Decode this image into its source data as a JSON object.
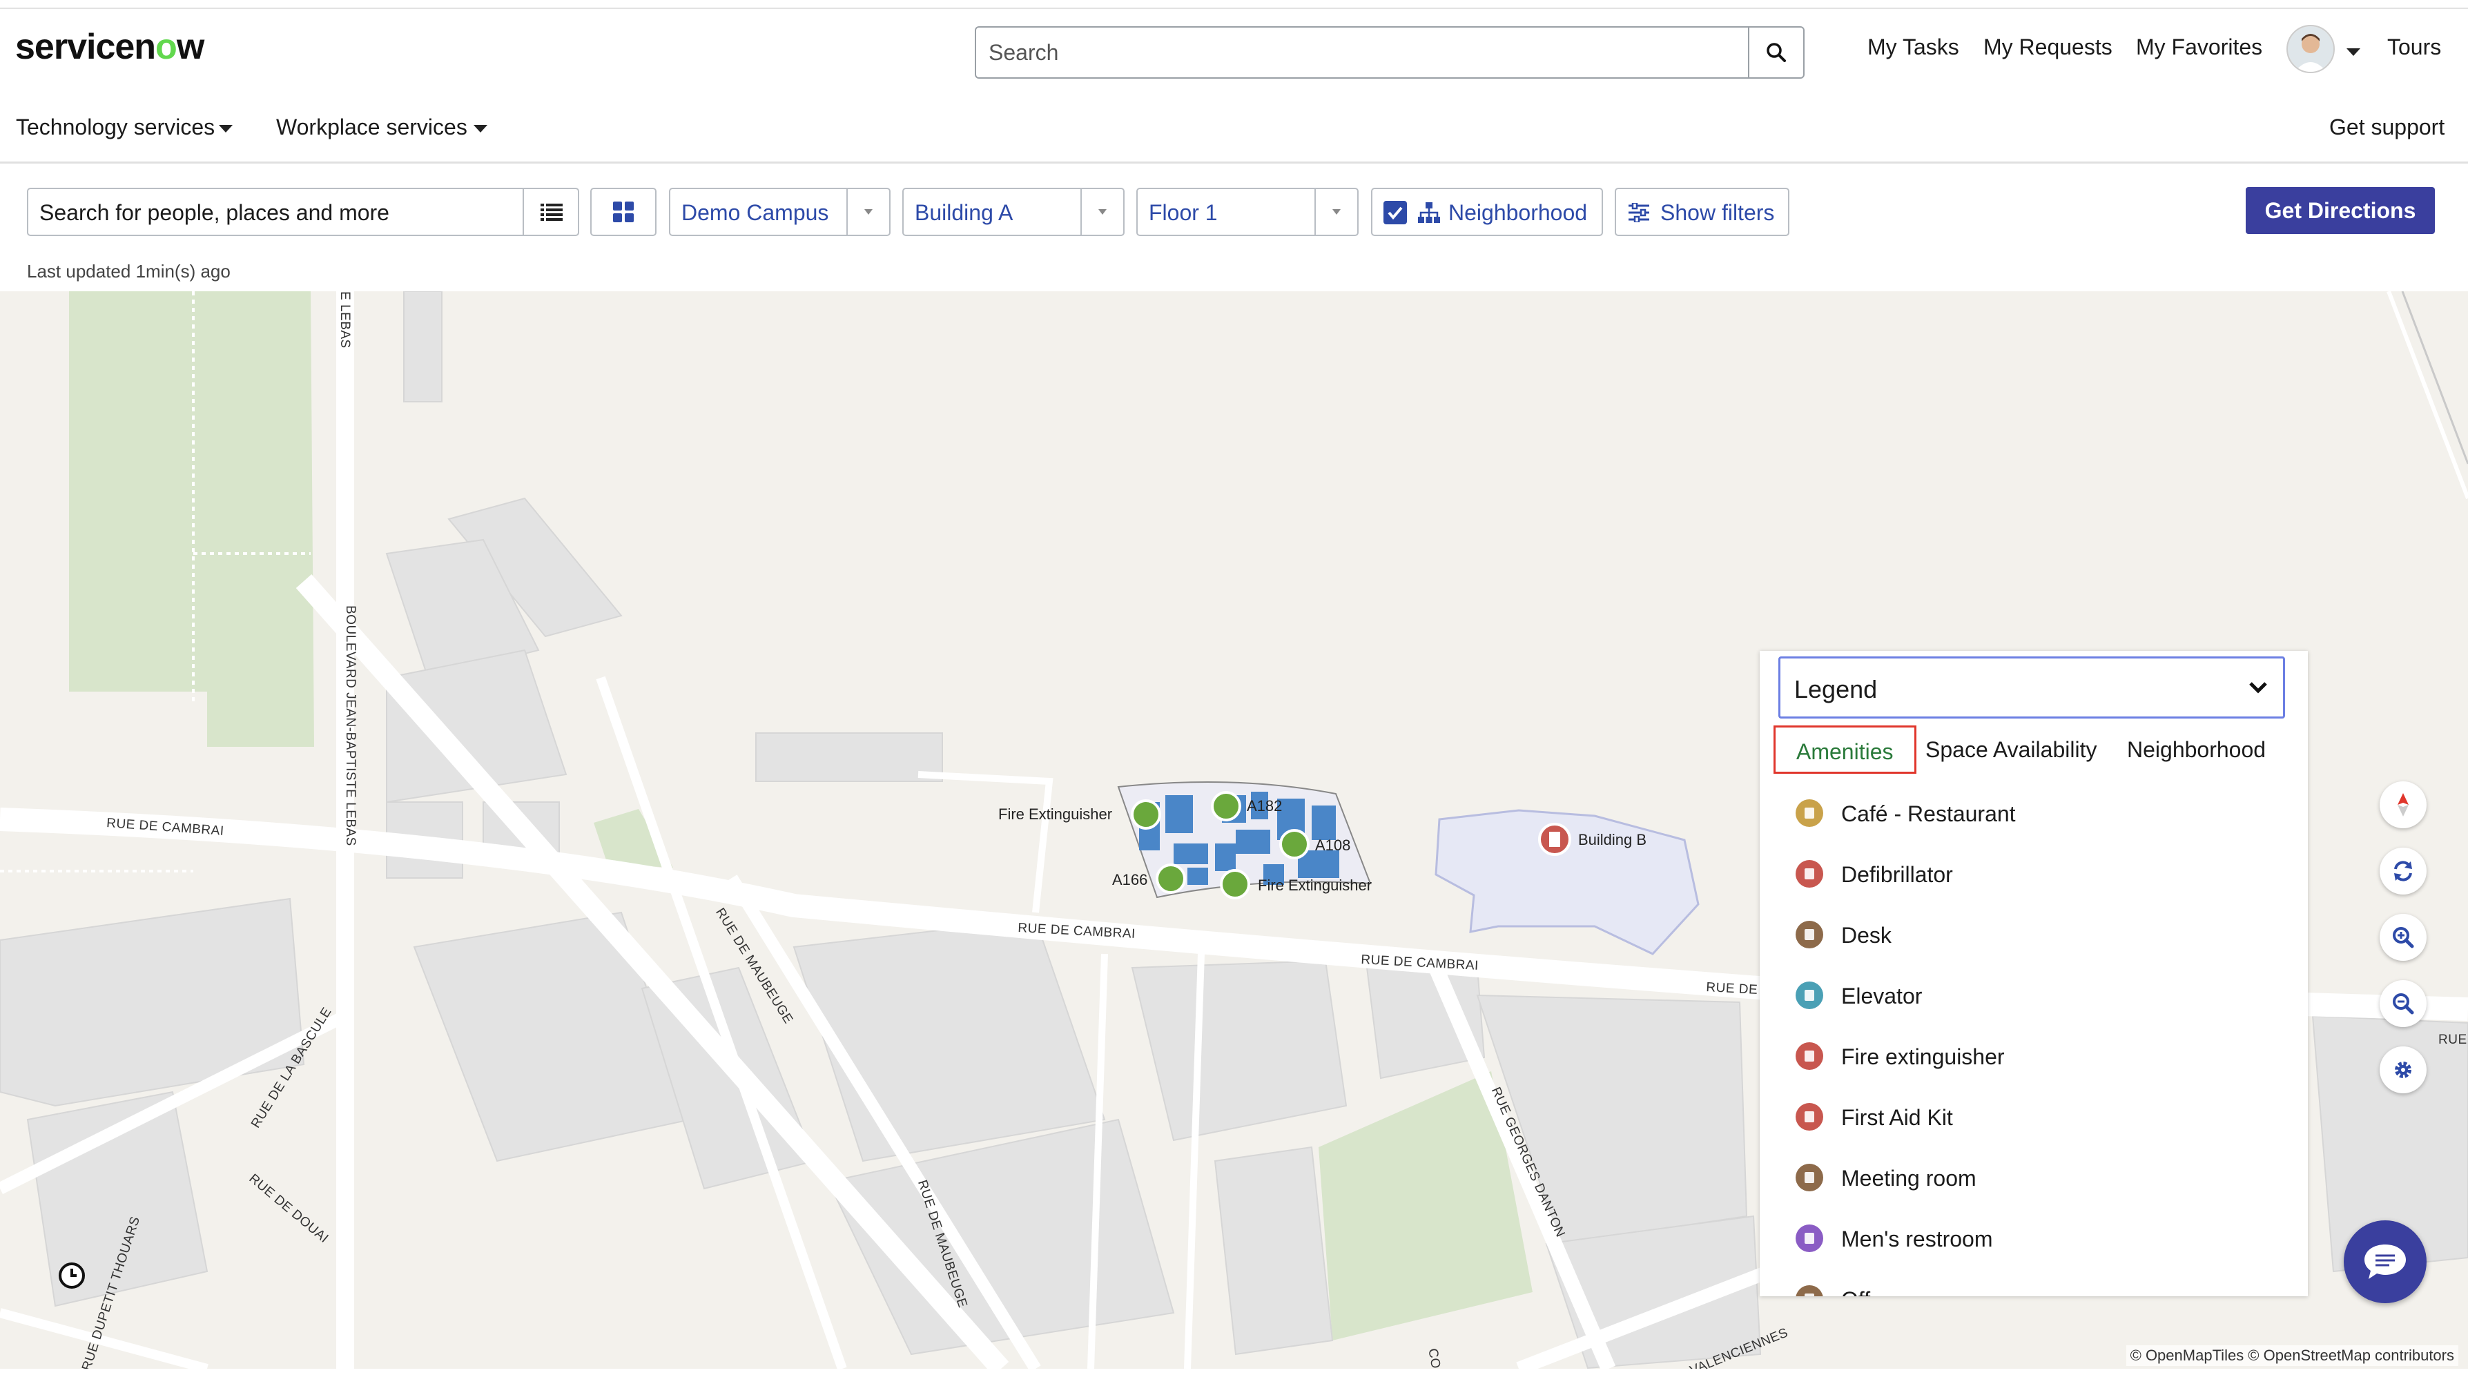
{
  "header": {
    "logo_text": "servicenow",
    "search_placeholder": "Search",
    "links": [
      "My Tasks",
      "My Requests",
      "My Favorites",
      "Tours"
    ]
  },
  "nav": {
    "technology_services": "Technology services",
    "workplace_services": "Workplace services",
    "get_support": "Get support"
  },
  "toolbar": {
    "search_placeholder": "Search for people, places and more",
    "campus": "Demo Campus",
    "building": "Building A",
    "floor": "Floor 1",
    "neighborhood_label": "Neighborhood",
    "neighborhood_checked": true,
    "show_filters": "Show filters",
    "get_directions": "Get Directions",
    "last_updated": "Last updated 1min(s) ago"
  },
  "map": {
    "pois": [
      "Fire Extinguisher",
      "A182",
      "A108",
      "A166",
      "Fire Extinguisher"
    ],
    "building_b": "Building B",
    "streets": [
      "RUE DE CAMBRAI",
      "RUE DE CAMBRAI",
      "RUE DE CAMBRAI",
      "RUE DE C",
      "RUE",
      "BOULEVARD JEAN-BAPTISTE LEBAS",
      "E LEBAS",
      "RUE DE MAUBEUGE",
      "RUE DE MAUBEUGE",
      "RUE DE LA BASCULE",
      "RUE DE DOUAI",
      "RUE DUPETIT THOUARS",
      "RUE GEORGES DANTON",
      "VALENCIENNES",
      "CO"
    ],
    "attribution": "© OpenMapTiles © OpenStreetMap contributors"
  },
  "legend": {
    "title": "Legend",
    "tabs": [
      "Amenities",
      "Space Availability",
      "Neighborhood"
    ],
    "active_tab": "Amenities",
    "items": [
      {
        "label": "Café - Restaurant",
        "color": "#c9a24a",
        "icon": "cafe-icon"
      },
      {
        "label": "Defibrillator",
        "color": "#c8574f",
        "icon": "defibrillator-icon"
      },
      {
        "label": "Desk",
        "color": "#8d6a4a",
        "icon": "desk-icon"
      },
      {
        "label": "Elevator",
        "color": "#4aa0b5",
        "icon": "elevator-icon"
      },
      {
        "label": "Fire extinguisher",
        "color": "#c8574f",
        "icon": "fire-extinguisher-icon"
      },
      {
        "label": "First Aid Kit",
        "color": "#c8574f",
        "icon": "first-aid-icon"
      },
      {
        "label": "Meeting room",
        "color": "#8d6a4a",
        "icon": "meeting-room-icon"
      },
      {
        "label": "Men's restroom",
        "color": "#8a5cc4",
        "icon": "mens-restroom-icon"
      },
      {
        "label": "Off",
        "color": "#8d6a4a",
        "icon": "office-icon"
      }
    ]
  }
}
